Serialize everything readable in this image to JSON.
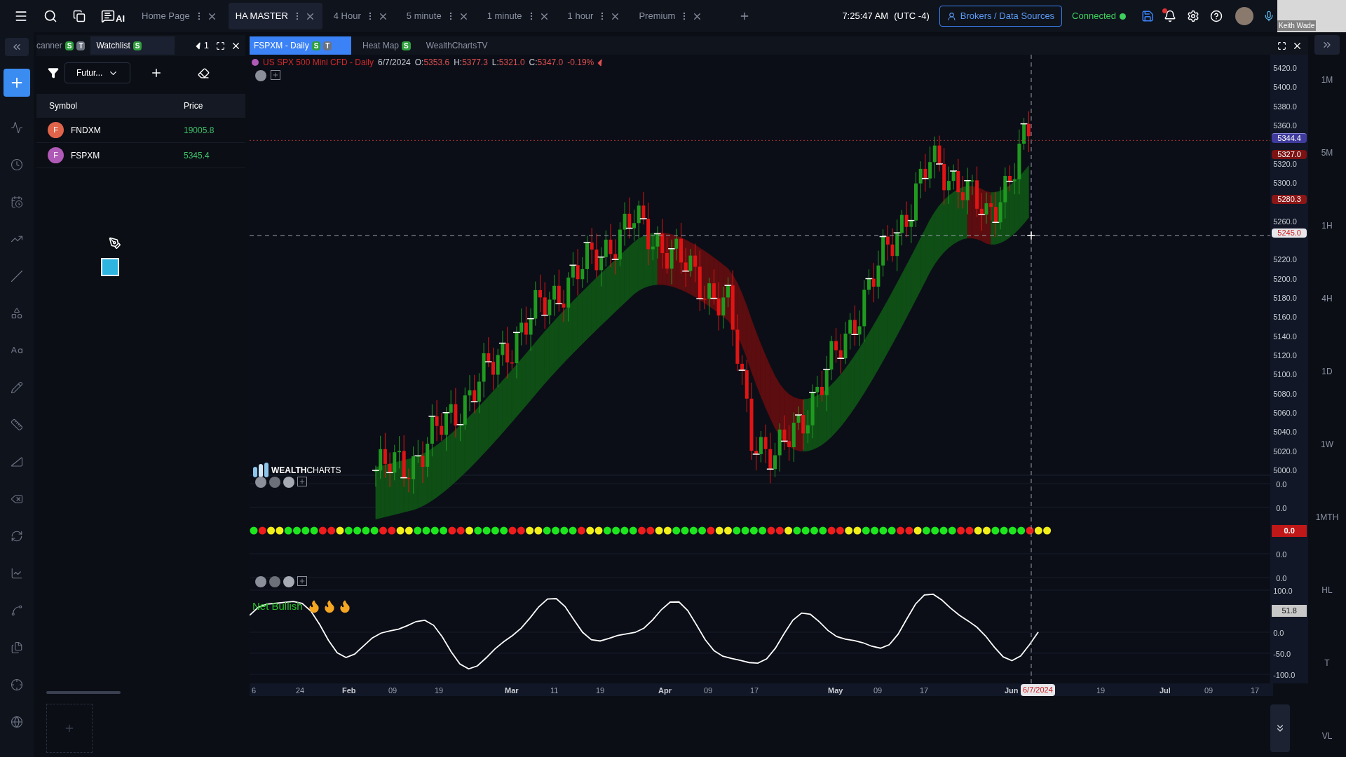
{
  "top_bar": {
    "ai_label": "AI",
    "tabs": [
      {
        "label": "Home Page",
        "selected": false
      },
      {
        "label": "HA MASTER",
        "selected": true
      },
      {
        "label": "4 Hour",
        "selected": false
      },
      {
        "label": "5 minute",
        "selected": false
      },
      {
        "label": "1 minute",
        "selected": false
      },
      {
        "label": "1 hour",
        "selected": false
      },
      {
        "label": "Premium",
        "selected": false
      }
    ],
    "time": "7:25:47 AM",
    "timezone": "(UTC -4)",
    "brokers_button": "Brokers / Data Sources",
    "status": "Connected",
    "user_name": "Keith Wade"
  },
  "left_panel": {
    "tabs": [
      {
        "label": "canner",
        "badges": [
          "S",
          "T"
        ],
        "selected": false
      },
      {
        "label": "Watchlist",
        "badges": [
          "S"
        ],
        "selected": true
      }
    ],
    "count": "1",
    "filter": "Futur...",
    "columns": [
      "Symbol",
      "Price"
    ],
    "rows": [
      {
        "initial": "F",
        "symbol": "FNDXM",
        "price": "19005.8",
        "color": "#e0644a"
      },
      {
        "initial": "F",
        "symbol": "FSPXM",
        "price": "5345.4",
        "color": "#b05ab8"
      }
    ]
  },
  "chart_tabs": [
    {
      "label": "FSPXM - Daily",
      "badges": [
        "S",
        "T"
      ],
      "selected": true
    },
    {
      "label": "Heat Map",
      "badges": [
        "S"
      ],
      "selected": false
    },
    {
      "label": "WealthChartsTV",
      "selected": false
    }
  ],
  "legend": {
    "title": "US SPX 500 Mini CFD - Daily",
    "date": "6/7/2024",
    "ohlc": [
      {
        "label": "O:",
        "value": "5353.6"
      },
      {
        "label": "H:",
        "value": "5377.3"
      },
      {
        "label": "L:",
        "value": "5321.0"
      },
      {
        "label": "C:",
        "value": "5347.0"
      }
    ],
    "change": "-0.19%"
  },
  "logo": {
    "bold": "WEALTH",
    "rest": "CHARTS"
  },
  "price_axis": [
    "5420.0",
    "5400.0",
    "5380.0",
    "5360.0",
    "5320.0",
    "5300.0",
    "5260.0",
    "5220.0",
    "5200.0",
    "5180.0",
    "5160.0",
    "5140.0",
    "5120.0",
    "5100.0",
    "5080.0",
    "5060.0",
    "5040.0",
    "5020.0",
    "5000.0"
  ],
  "price_tags": [
    {
      "text": "5344.4",
      "kind": "last",
      "color": "#3f3b9c"
    },
    {
      "text": "5327.0",
      "kind": "level",
      "color": "#7c1212"
    },
    {
      "text": "5280.3",
      "kind": "level",
      "color": "#8a1616"
    },
    {
      "text": "5245.0",
      "kind": "crosshair",
      "color": "#e8e8ec"
    }
  ],
  "indicator_axis": [
    "0.0",
    "0.0",
    "0.0",
    "0.0"
  ],
  "indicator_tag": "0.0",
  "oscillator": {
    "label": "Net Bullish",
    "axis": [
      "100.0",
      "0.0",
      "-50.0",
      "-100.0"
    ],
    "tag": "51.8"
  },
  "time_axis": [
    {
      "label": "6",
      "kind": "day"
    },
    {
      "label": "24",
      "kind": "day"
    },
    {
      "label": "Feb",
      "kind": "month"
    },
    {
      "label": "09",
      "kind": "day"
    },
    {
      "label": "19",
      "kind": "day"
    },
    {
      "label": "Mar",
      "kind": "month"
    },
    {
      "label": "11",
      "kind": "day"
    },
    {
      "label": "19",
      "kind": "day"
    },
    {
      "label": "Apr",
      "kind": "month"
    },
    {
      "label": "09",
      "kind": "day"
    },
    {
      "label": "17",
      "kind": "day"
    },
    {
      "label": "May",
      "kind": "month"
    },
    {
      "label": "09",
      "kind": "day"
    },
    {
      "label": "17",
      "kind": "day"
    },
    {
      "label": "Jun",
      "kind": "month"
    },
    {
      "label": "19",
      "kind": "day"
    },
    {
      "label": "Jul",
      "kind": "month"
    },
    {
      "label": "09",
      "kind": "day"
    },
    {
      "label": "17",
      "kind": "day"
    }
  ],
  "crosshair_date": "6/7/2024",
  "timeframes": [
    "1M",
    "5M",
    "1H",
    "4H",
    "1D",
    "1W",
    "1MTH",
    "HL",
    "T",
    "VL"
  ]
}
